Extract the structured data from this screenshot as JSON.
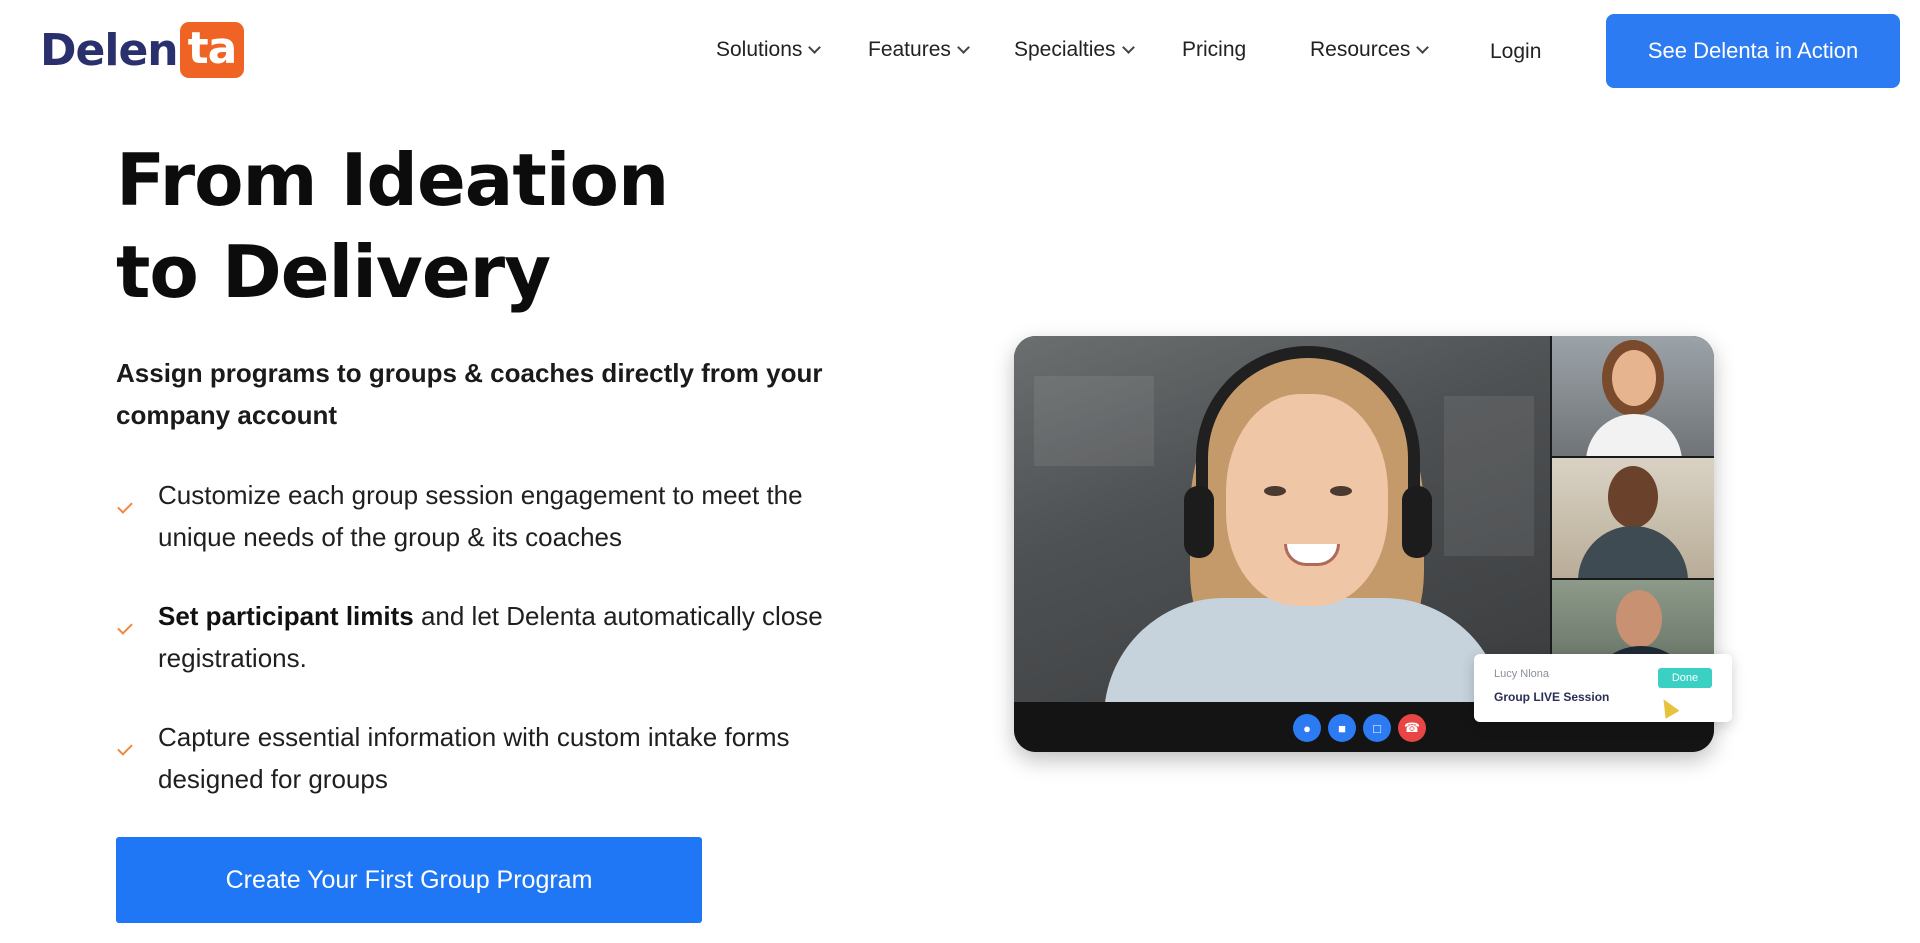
{
  "brand": {
    "logo_part1": "Delen",
    "logo_part2": "ta",
    "accent": "#ef6424",
    "primary": "#2a2f6d"
  },
  "nav": {
    "items": [
      {
        "label": "Solutions",
        "dropdown": true
      },
      {
        "label": "Features",
        "dropdown": true
      },
      {
        "label": "Specialties",
        "dropdown": true
      },
      {
        "label": "Pricing",
        "dropdown": false
      },
      {
        "label": "Resources",
        "dropdown": true
      },
      {
        "label": "Login",
        "dropdown": false
      }
    ],
    "cta_label": "See Delenta in Action"
  },
  "hero": {
    "headline_line1": "From Ideation",
    "headline_line2": "to Delivery",
    "subhead": "Assign programs to groups & coaches directly from your company account",
    "bullets": [
      {
        "bold": "",
        "text": "Customize each group session engagement to meet the unique needs of the group & its coaches"
      },
      {
        "bold": "Set participant limits",
        "text": " and let Delenta automatically close registrations."
      },
      {
        "bold": "",
        "text": "Capture essential information with custom intake forms designed for groups"
      }
    ],
    "cta_label": "Create Your First Group Program"
  },
  "video": {
    "session": {
      "participant_name": "Lucy Nlona",
      "title": "Group LIVE Session",
      "done_label": "Done"
    },
    "control_icons": [
      "microphone-icon",
      "camera-icon",
      "chat-icon",
      "hang-up-icon"
    ],
    "control_colors": [
      "#2c7bf2",
      "#2c7bf2",
      "#2c7bf2",
      "#e84545"
    ]
  }
}
